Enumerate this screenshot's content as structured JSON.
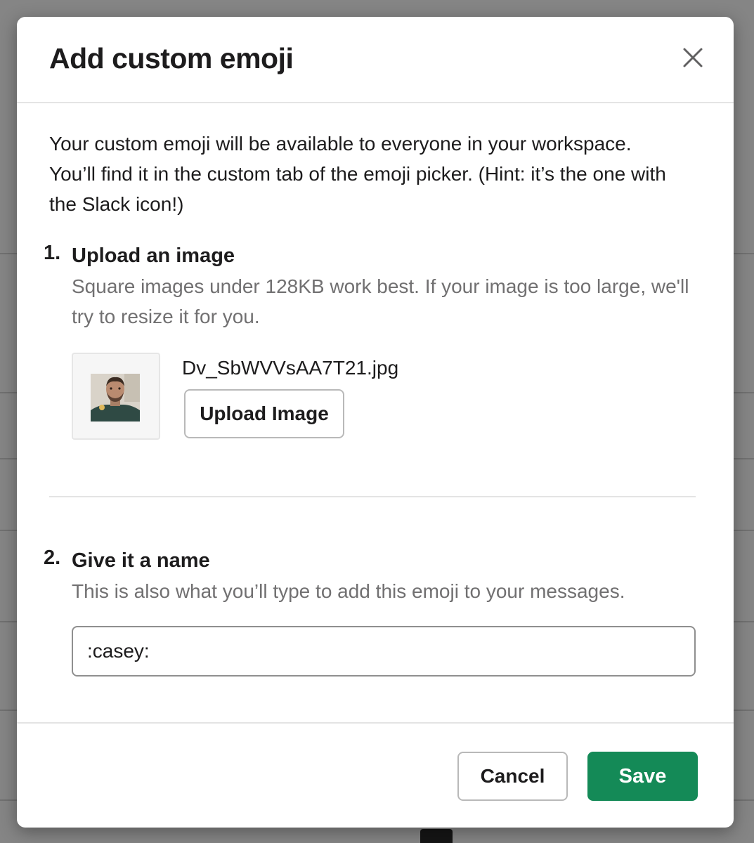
{
  "modal": {
    "title": "Add custom emoji",
    "intro": "Your custom emoji will be available to everyone in your workspace. You’ll find it in the custom tab of the emoji picker. (Hint: it’s the one with the Slack icon!)",
    "step1": {
      "number": "1.",
      "title": "Upload an image",
      "description": "Square images under 128KB work best. If your image is too large, we'll try to resize it for you.",
      "file_name": "Dv_SbWVVsAA7T21.jpg",
      "upload_label": "Upload Image"
    },
    "step2": {
      "number": "2.",
      "title": "Give it a name",
      "description": "This is also what you’ll type to add this emoji to your messages.",
      "input_value": ":casey:"
    },
    "footer": {
      "cancel_label": "Cancel",
      "save_label": "Save"
    }
  },
  "icons": {
    "close": "close-icon"
  },
  "colors": {
    "primary_button": "#148a57",
    "text": "#1d1c1d",
    "muted_text": "#717071"
  }
}
